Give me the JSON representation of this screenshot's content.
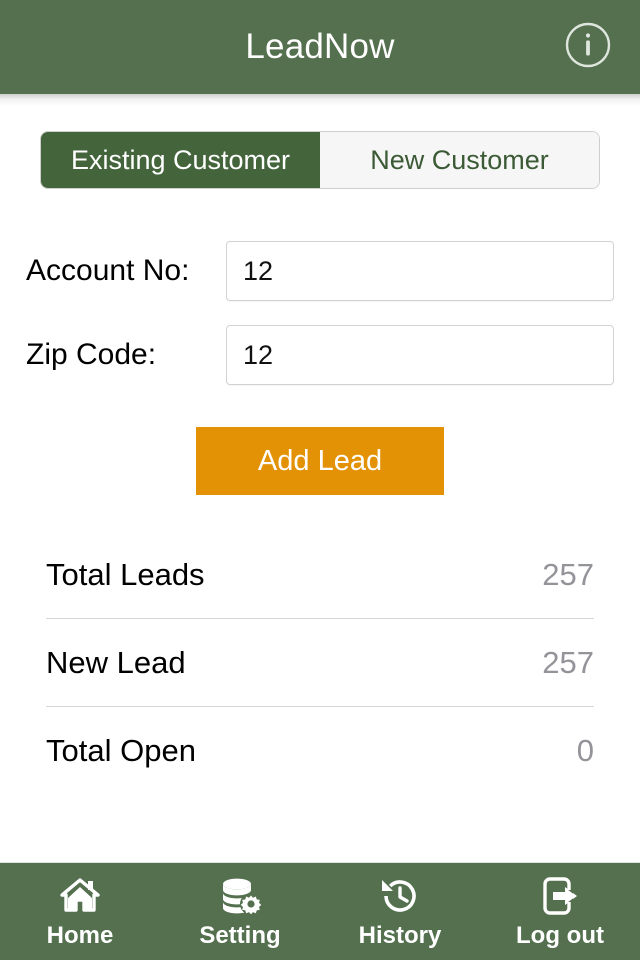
{
  "header": {
    "title": "LeadNow",
    "info_icon": "info-circle-icon",
    "background_color": "#54704f"
  },
  "segmented_control": {
    "options": [
      {
        "label": "Existing Customer",
        "selected": true
      },
      {
        "label": "New Customer",
        "selected": false
      }
    ],
    "active_color": "#44653c",
    "inactive_color": "#f6f6f6"
  },
  "form": {
    "fields": [
      {
        "label": "Account No:",
        "value": "12",
        "placeholder": ""
      },
      {
        "label": "Zip Code:",
        "value": "12",
        "placeholder": ""
      }
    ]
  },
  "primary_action": {
    "label": "Add Lead",
    "color": "#e39205"
  },
  "stats": {
    "rows": [
      {
        "label": "Total Leads",
        "value": "257"
      },
      {
        "label": "New Lead",
        "value": "257"
      },
      {
        "label": "Total Open",
        "value": "0"
      }
    ],
    "value_color": "#939399"
  },
  "tabbar": {
    "background_color": "#54704f",
    "tabs": [
      {
        "label": "Home",
        "icon": "home-icon"
      },
      {
        "label": "Setting",
        "icon": "database-gear-icon"
      },
      {
        "label": "History",
        "icon": "clock-rewind-icon"
      },
      {
        "label": "Log out",
        "icon": "logout-arrow-icon"
      }
    ]
  }
}
